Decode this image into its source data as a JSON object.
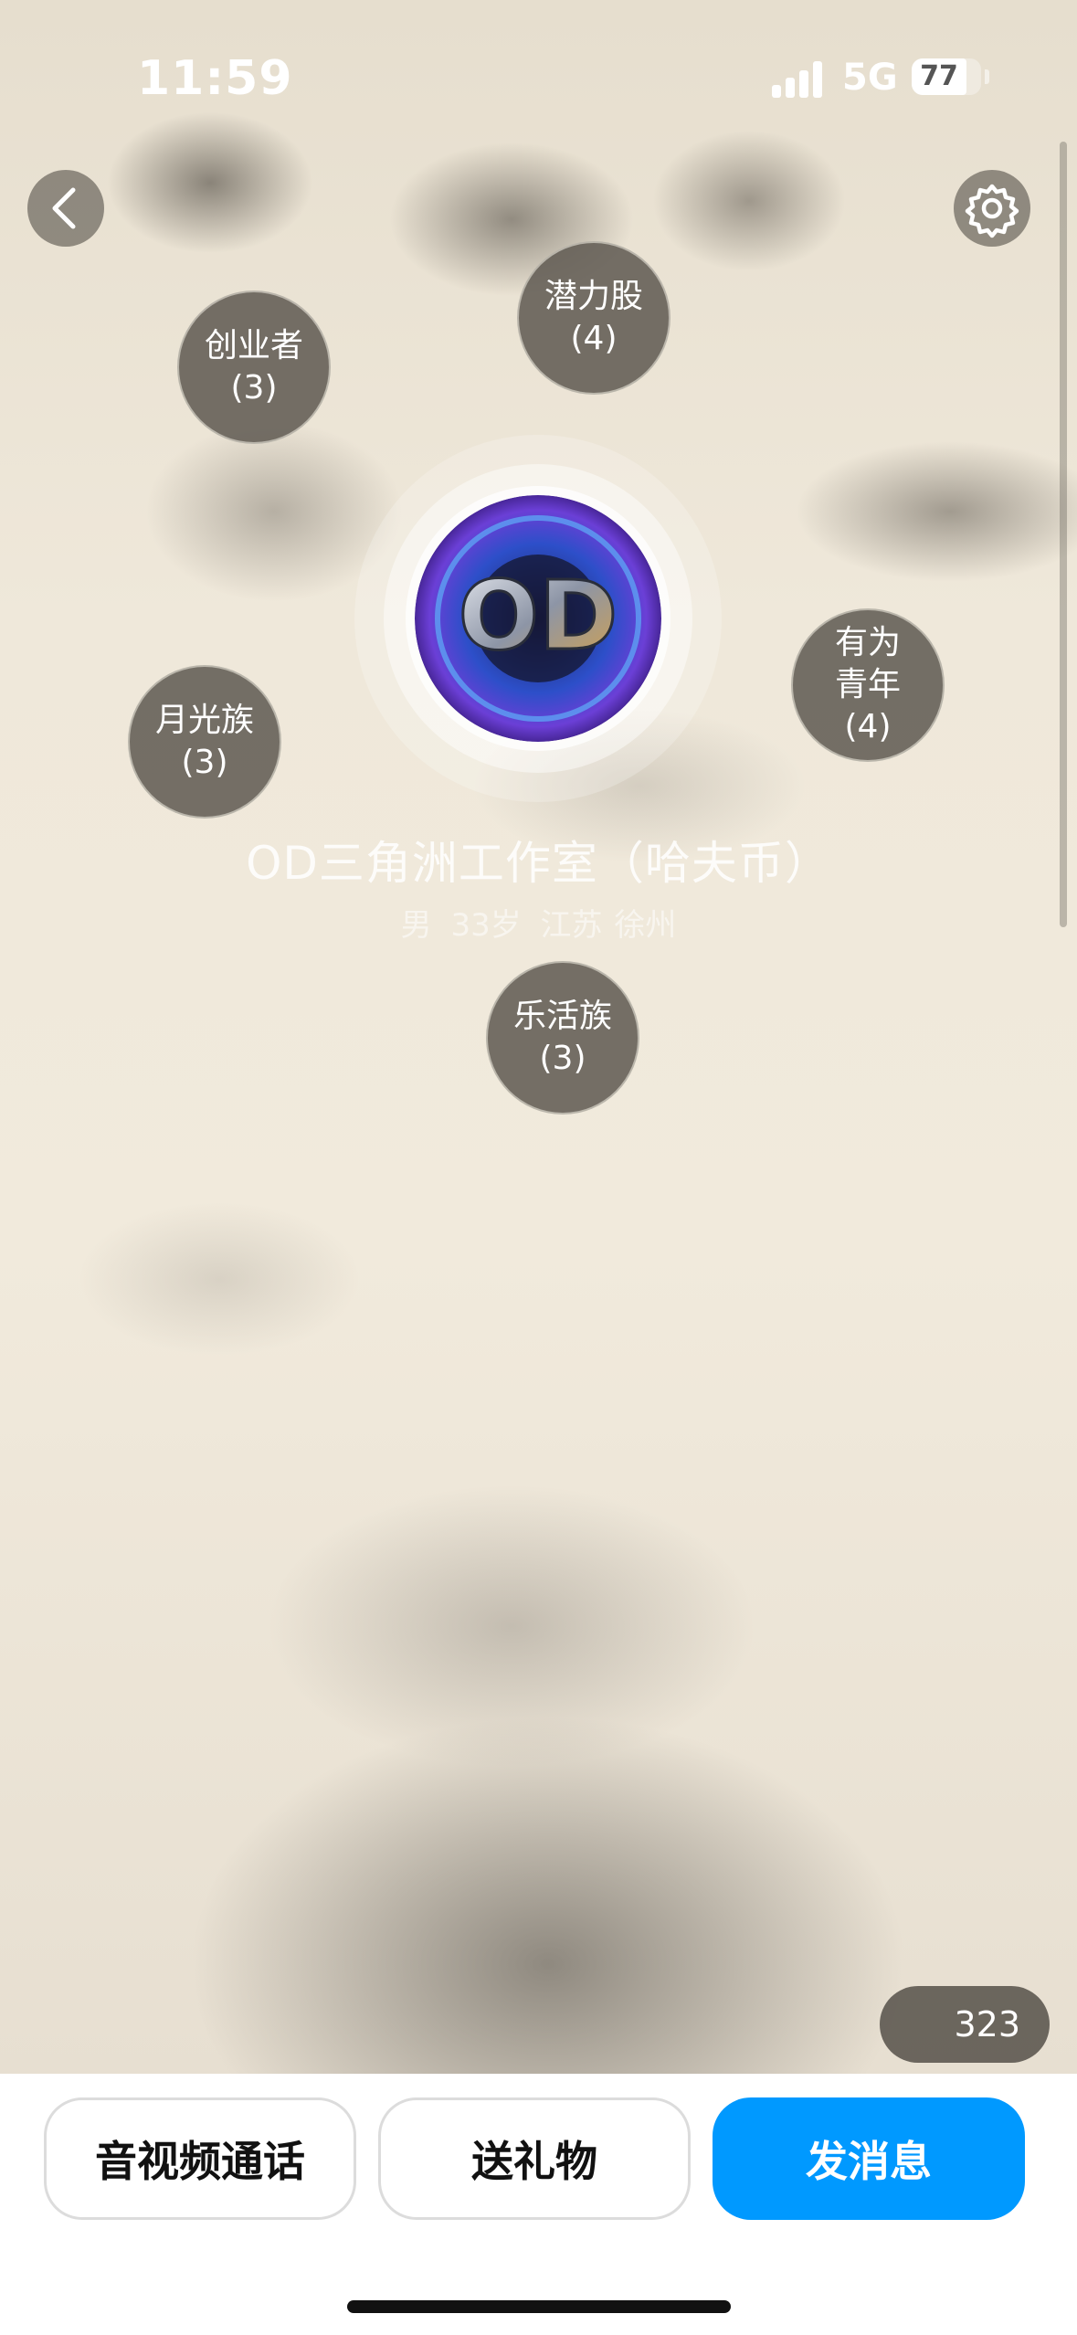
{
  "status_bar": {
    "time": "11:59",
    "network": "5G",
    "battery": "77"
  },
  "profile": {
    "name": "OD三角洲工作室（哈夫币）",
    "gender": "男",
    "age": "33岁",
    "province": "江苏",
    "city": "徐州",
    "avatar_text": "OD"
  },
  "tags": [
    {
      "label": "潜力股",
      "count": "(4)"
    },
    {
      "label": "创业者",
      "count": "(3)"
    },
    {
      "label": "有为青年",
      "count": "(4)"
    },
    {
      "label": "月光族",
      "count": "(3)"
    },
    {
      "label": "乐活族",
      "count": "(3)"
    }
  ],
  "visitor_count": "323",
  "actions": {
    "call_label": "音视频通话",
    "gift_label": "送礼物",
    "message_label": "发消息"
  },
  "colors": {
    "primary": "#0099ff",
    "tag_bg": "#625c54"
  },
  "icons": {
    "back": "chevron-left-icon",
    "settings": "gear-icon"
  }
}
